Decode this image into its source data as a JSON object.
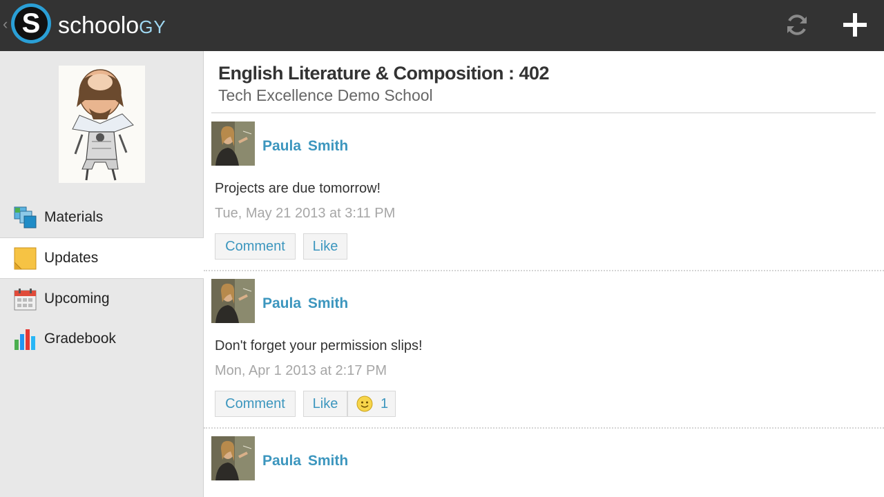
{
  "app": {
    "name_main": "schoolo",
    "name_suffix": "GY",
    "logo_letter": "S",
    "back_glyph": "‹"
  },
  "toolbar": {
    "refresh_icon": "refresh-icon",
    "add_icon": "plus-icon"
  },
  "sidebar": {
    "items": [
      {
        "label": "Materials",
        "icon": "materials-icon"
      },
      {
        "label": "Updates",
        "icon": "updates-icon",
        "active": true
      },
      {
        "label": "Upcoming",
        "icon": "calendar-icon"
      },
      {
        "label": "Gradebook",
        "icon": "gradebook-icon"
      }
    ]
  },
  "course": {
    "title": "English Literature & Composition : 402",
    "school": "Tech Excellence Demo School"
  },
  "posts": [
    {
      "author": "Paula  Smith",
      "message": "Projects are due tomorrow!",
      "time": "Tue, May 21 2013 at 3:11 PM",
      "comment_label": "Comment",
      "like_label": "Like"
    },
    {
      "author": "Paula  Smith",
      "message": "Don't forget your permission slips!",
      "time": "Mon, Apr 1 2013 at 2:17 PM",
      "comment_label": "Comment",
      "like_label": "Like",
      "like_count": "1"
    },
    {
      "author": "Paula  Smith"
    }
  ],
  "colors": {
    "topbar": "#333333",
    "accent": "#3c96be",
    "sidebar": "#e8e8e8",
    "logo_ring": "#2a9fd6"
  }
}
